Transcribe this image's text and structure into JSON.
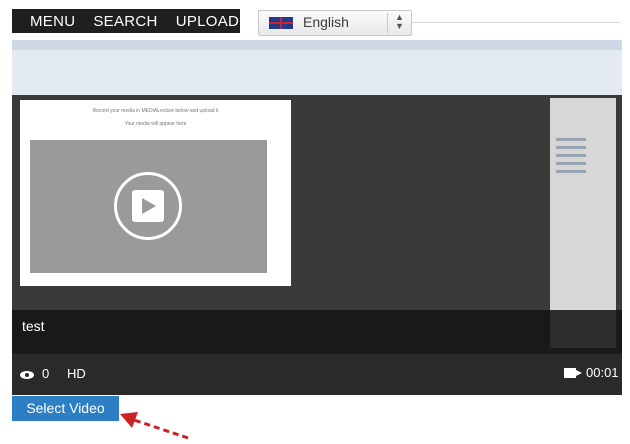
{
  "menu": {
    "items": [
      "MENU",
      "SEARCH",
      "UPLOAD"
    ]
  },
  "language": {
    "selected": "English",
    "icon": "uk-flag-icon"
  },
  "player": {
    "screenshot_text": [
      "Record your media in MEDIALecture below and upload it",
      "Your media will appear here"
    ],
    "caption": "test",
    "views": "0",
    "quality": "HD",
    "duration": "00:01"
  },
  "actions": {
    "select_video": "Select Video"
  },
  "colors": {
    "accent": "#2d7fc3",
    "arrow": "#cc2222",
    "nav": "#1f1f1f"
  }
}
